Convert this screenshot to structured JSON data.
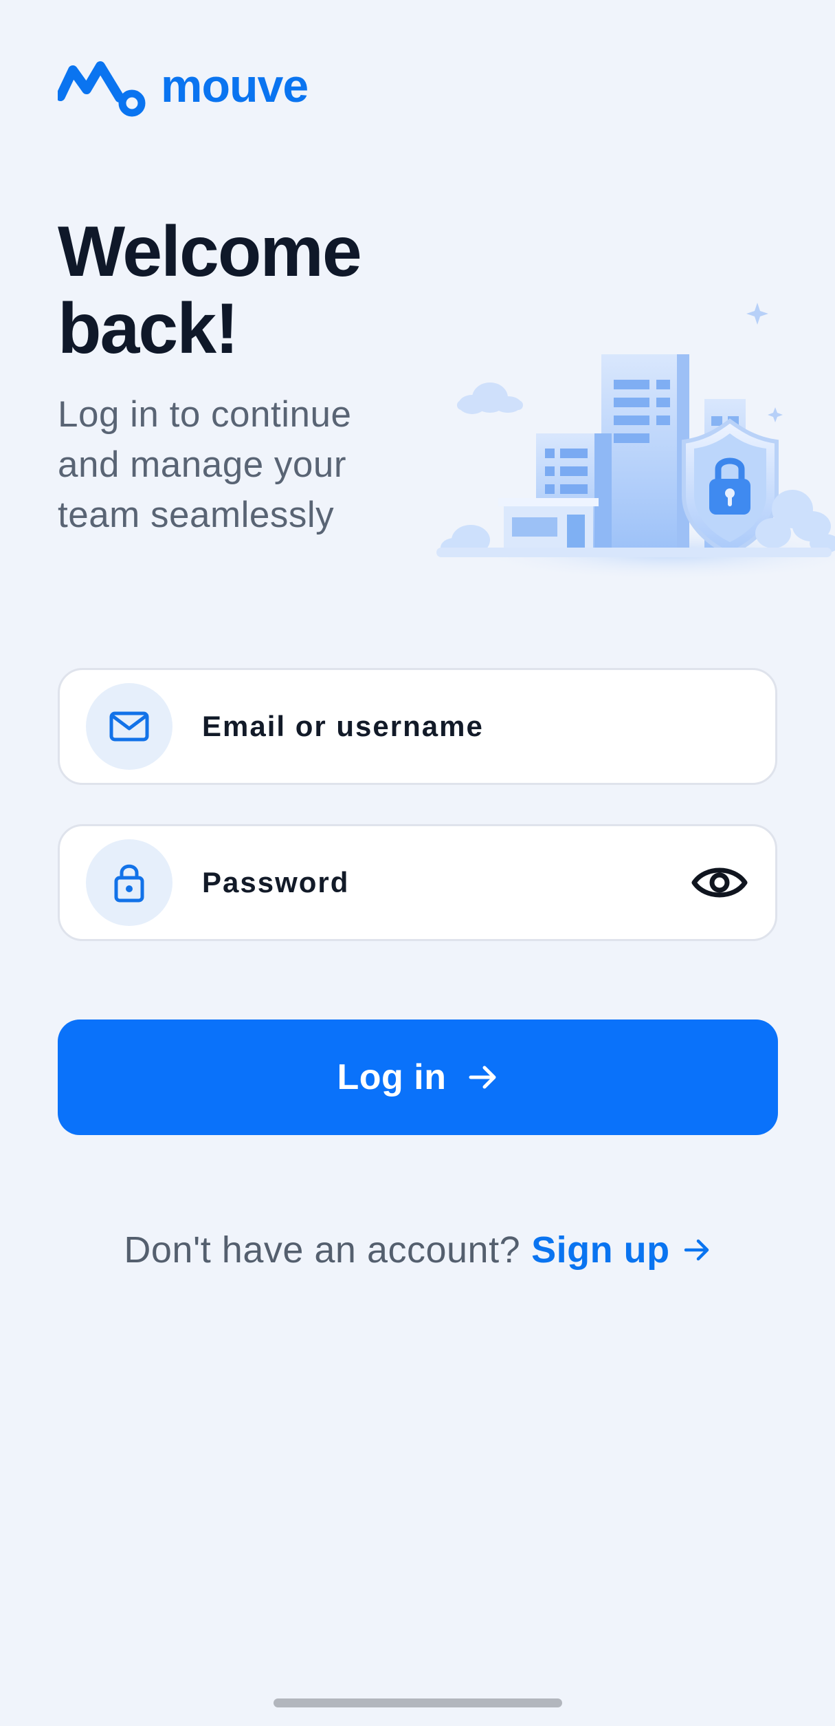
{
  "brand": {
    "name": "mouve",
    "color": "#0a74f0"
  },
  "heading": {
    "title": "Welcome back!",
    "subtitle": "Log in to continue and manage your team seamlessly"
  },
  "hero": {
    "icon": "secure-buildings-illustration"
  },
  "form": {
    "email": {
      "label": "Email or username",
      "icon": "mail-icon"
    },
    "password": {
      "label": "Password",
      "icon": "lock-icon",
      "toggle_icon": "eye-icon"
    }
  },
  "login_button": {
    "label": "Log in",
    "icon": "arrow-right-icon",
    "color": "#0a72fa"
  },
  "signup": {
    "prompt": "Don't have an account?",
    "link_label": "Sign up",
    "icon": "arrow-right-icon"
  }
}
